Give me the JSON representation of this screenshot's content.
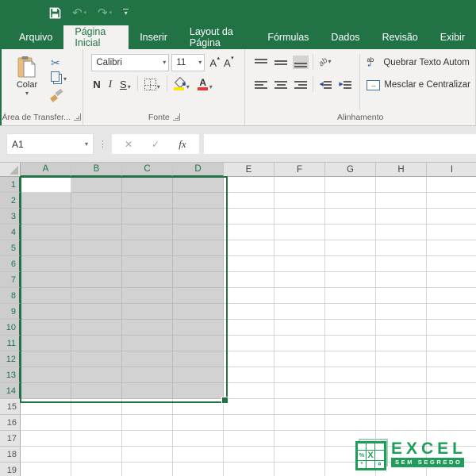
{
  "colors": {
    "excel_green": "#217346",
    "selection_fill": "#d2d2d2",
    "watermark_green": "#1e9e5a",
    "fill_color_swatch": "#ffe600",
    "font_color_swatch": "#e03c31"
  },
  "icons": {
    "caret_down": "▾",
    "caret_up": "▴",
    "undo": "↶",
    "redo": "↷",
    "scissors": "✂",
    "merge_arrows": "↔",
    "wrap_letters": "ab",
    "wrap_arrow": "↲",
    "orientation_letters": "ab",
    "left_triangle": "◀",
    "right_triangle": "▶",
    "dots_separator": "⋮",
    "percent": "%",
    "x_mark": "X",
    "asterisk": "*",
    "sigma": "¤"
  },
  "ribbon_tabs": [
    {
      "label": "Arquivo",
      "active": false
    },
    {
      "label": "Página Inicial",
      "active": true
    },
    {
      "label": "Inserir",
      "active": false
    },
    {
      "label": "Layout da Página",
      "active": false
    },
    {
      "label": "Fórmulas",
      "active": false
    },
    {
      "label": "Dados",
      "active": false
    },
    {
      "label": "Revisão",
      "active": false
    },
    {
      "label": "Exibir",
      "active": false
    }
  ],
  "ribbon": {
    "clipboard_group": {
      "paste_label": "Colar",
      "group_label": "Área de Transfer..."
    },
    "font_group": {
      "font_name": "Calibri",
      "font_size": "11",
      "grow_font_label": "A",
      "shrink_font_label": "A",
      "bold_label": "N",
      "italic_label": "I",
      "underline_label": "S",
      "group_label": "Fonte"
    },
    "alignment_group": {
      "wrap_text_label": "Quebrar Texto Autom",
      "merge_center_label": "Mesclar e Centralizar",
      "group_label": "Alinhamento"
    }
  },
  "formula_bar": {
    "name_box_value": "A1",
    "cancel": "✕",
    "enter": "✓",
    "insert_function": "fx",
    "formula_value": ""
  },
  "grid": {
    "column_headers": [
      "A",
      "B",
      "C",
      "D",
      "E",
      "F",
      "G",
      "H",
      "I"
    ],
    "row_headers": [
      "1",
      "2",
      "3",
      "4",
      "5",
      "6",
      "7",
      "8",
      "9",
      "10",
      "11",
      "12",
      "13",
      "14",
      "15",
      "16",
      "17",
      "18",
      "19"
    ],
    "selection": {
      "range": "A1:D14",
      "active_cell": "A1",
      "selected_columns": [
        "A",
        "B",
        "C",
        "D"
      ],
      "selected_rows_count": 14
    }
  },
  "watermark": {
    "title": "EXCEL",
    "subtitle": "SEM SEGREDO"
  }
}
